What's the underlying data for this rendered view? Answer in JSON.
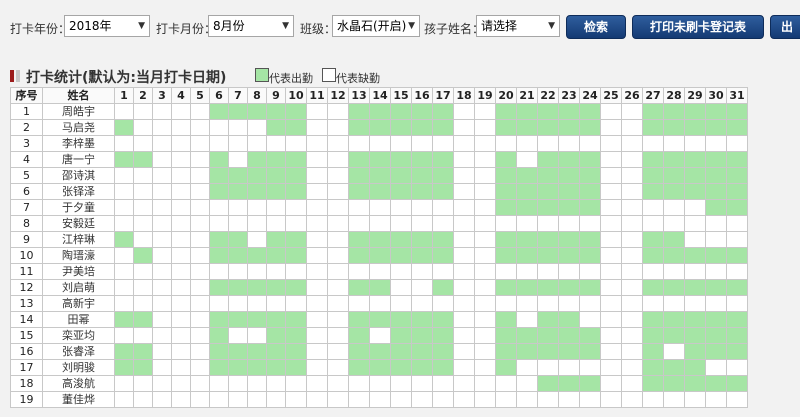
{
  "filters": {
    "year_label": "打卡年份：",
    "year_value": "2018年",
    "month_label": "打卡月份：",
    "month_value": "8月份",
    "class_label": "班级：",
    "class_value": "水晶石(开启)",
    "child_label": "孩子姓名：",
    "child_value": "请选择",
    "search_label": "检索",
    "print_label": "打印未刷卡登记表",
    "third_label": "出"
  },
  "section": {
    "title": "打卡统计(默认为:当月打卡日期)",
    "legend_present": "代表出勤",
    "legend_absent": "代表缺勤"
  },
  "colors": {
    "present": "#a5e5a5",
    "absent": "#ffffff",
    "button": "#1f4b88",
    "title_mark": "#9b1c1c"
  },
  "table": {
    "headers": [
      "序号",
      "姓名"
    ],
    "days": [
      1,
      2,
      3,
      4,
      5,
      6,
      7,
      8,
      9,
      10,
      11,
      12,
      13,
      14,
      15,
      16,
      17,
      18,
      19,
      20,
      21,
      22,
      23,
      24,
      25,
      26,
      27,
      28,
      29,
      30,
      31
    ],
    "rows": [
      {
        "no": "1",
        "name": "周皓宇",
        "present": [
          6,
          7,
          8,
          9,
          10,
          13,
          14,
          15,
          16,
          17,
          20,
          21,
          22,
          23,
          24,
          27,
          28,
          29,
          30,
          31
        ]
      },
      {
        "no": "2",
        "name": "马启尧",
        "present": [
          1,
          9,
          10,
          13,
          14,
          15,
          16,
          17,
          20,
          21,
          22,
          23,
          24,
          27,
          28,
          29,
          30,
          31
        ]
      },
      {
        "no": "3",
        "name": "李梓墨",
        "present": []
      },
      {
        "no": "4",
        "name": "唐一宁",
        "present": [
          1,
          2,
          6,
          8,
          9,
          10,
          13,
          14,
          15,
          16,
          17,
          20,
          22,
          23,
          24,
          27,
          28,
          29,
          30,
          31
        ]
      },
      {
        "no": "5",
        "name": "邵诗淇",
        "present": [
          6,
          7,
          8,
          9,
          10,
          13,
          14,
          15,
          16,
          17,
          20,
          21,
          22,
          23,
          24,
          27,
          28,
          29,
          30,
          31
        ]
      },
      {
        "no": "6",
        "name": "张铎泽",
        "present": [
          6,
          7,
          8,
          9,
          10,
          13,
          14,
          15,
          16,
          17,
          20,
          21,
          22,
          23,
          24,
          27,
          28,
          29,
          30,
          31
        ]
      },
      {
        "no": "7",
        "name": "于夕童",
        "present": [
          20,
          21,
          22,
          23,
          24,
          30,
          31
        ]
      },
      {
        "no": "8",
        "name": "安毅廷",
        "present": []
      },
      {
        "no": "9",
        "name": "江梓琳",
        "present": [
          1,
          6,
          7,
          9,
          10,
          13,
          14,
          15,
          16,
          17,
          20,
          21,
          22,
          23,
          24,
          27,
          28
        ]
      },
      {
        "no": "10",
        "name": "陶瑨濠",
        "present": [
          2,
          6,
          7,
          8,
          9,
          10,
          13,
          14,
          15,
          16,
          17,
          20,
          21,
          22,
          23,
          24,
          27,
          28,
          29,
          30,
          31
        ]
      },
      {
        "no": "11",
        "name": "尹美培",
        "present": []
      },
      {
        "no": "12",
        "name": "刘启萌",
        "present": [
          6,
          7,
          8,
          9,
          10,
          13,
          14,
          17,
          20,
          21,
          22,
          23,
          24,
          27,
          28,
          29,
          30,
          31
        ]
      },
      {
        "no": "13",
        "name": "高新宇",
        "present": []
      },
      {
        "no": "14",
        "name": "田幂",
        "present": [
          1,
          2,
          6,
          7,
          8,
          9,
          10,
          13,
          14,
          15,
          16,
          17,
          20,
          22,
          23,
          27,
          28,
          29,
          30,
          31
        ]
      },
      {
        "no": "15",
        "name": "栾亚均",
        "present": [
          6,
          9,
          10,
          13,
          15,
          16,
          17,
          20,
          21,
          22,
          23,
          24,
          27,
          28,
          29,
          30,
          31
        ]
      },
      {
        "no": "16",
        "name": "张睿泽",
        "present": [
          1,
          2,
          6,
          7,
          8,
          9,
          10,
          13,
          14,
          15,
          16,
          17,
          20,
          21,
          22,
          23,
          24,
          27,
          29,
          30,
          31
        ]
      },
      {
        "no": "17",
        "name": "刘明骏",
        "present": [
          1,
          2,
          6,
          7,
          8,
          9,
          10,
          13,
          14,
          15,
          16,
          17,
          20,
          27,
          28,
          29
        ]
      },
      {
        "no": "18",
        "name": "高浚航",
        "present": [
          22,
          23,
          24,
          27,
          28,
          29,
          30,
          31
        ]
      },
      {
        "no": "19",
        "name": "董佳烨",
        "present": []
      }
    ]
  }
}
